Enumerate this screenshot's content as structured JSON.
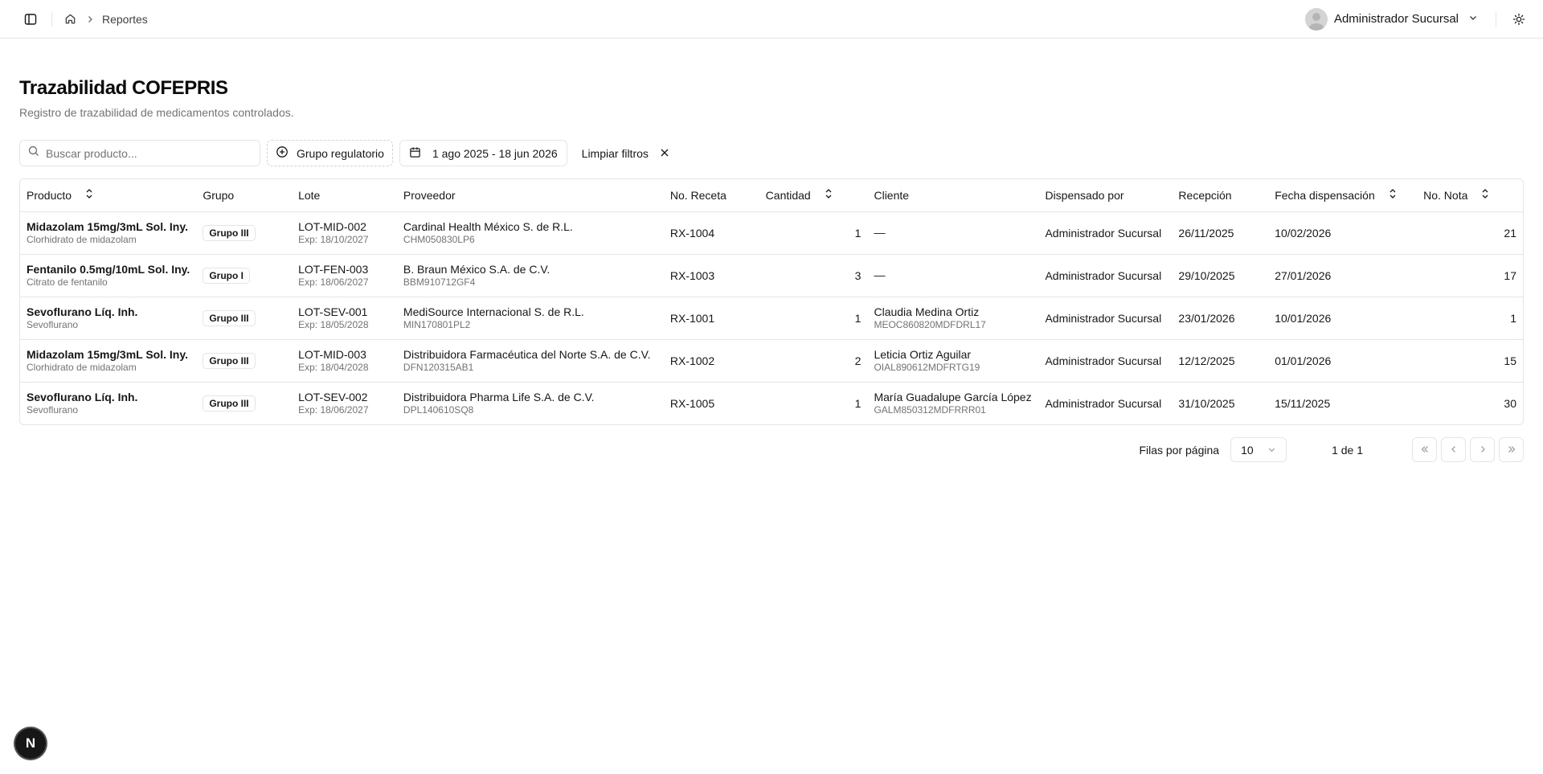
{
  "header": {
    "breadcrumb": [
      "Reportes"
    ],
    "user_name": "Administrador Sucursal"
  },
  "page": {
    "title": "Trazabilidad COFEPRIS",
    "subtitle": "Registro de trazabilidad de medicamentos controlados."
  },
  "filters": {
    "search_placeholder": "Buscar producto...",
    "group_filter_label": "Grupo regulatorio",
    "date_range": "1 ago 2025 - 18 jun 2026",
    "clear_label": "Limpiar filtros"
  },
  "table": {
    "columns": [
      "Producto",
      "Grupo",
      "Lote",
      "Proveedor",
      "No. Receta",
      "Cantidad",
      "Cliente",
      "Dispensado por",
      "Recepción",
      "Fecha dispensación",
      "No. Nota"
    ],
    "rows": [
      {
        "product": "Midazolam 15mg/3mL Sol. Iny.",
        "substance": "Clorhidrato de midazolam",
        "group": "Grupo III",
        "lot": "LOT-MID-002",
        "expiry": "Exp: 18/10/2027",
        "supplier": "Cardinal Health México S. de R.L.",
        "supplier_rfc": "CHM050830LP6",
        "prescription": "RX-1004",
        "quantity": "1",
        "client": "—",
        "client_curp": "",
        "dispensed_by": "Administrador Sucursal",
        "reception": "26/11/2025",
        "dispense_date": "10/02/2026",
        "note": "21"
      },
      {
        "product": "Fentanilo 0.5mg/10mL Sol. Iny.",
        "substance": "Citrato de fentanilo",
        "group": "Grupo I",
        "lot": "LOT-FEN-003",
        "expiry": "Exp: 18/06/2027",
        "supplier": "B. Braun México S.A. de C.V.",
        "supplier_rfc": "BBM910712GF4",
        "prescription": "RX-1003",
        "quantity": "3",
        "client": "—",
        "client_curp": "",
        "dispensed_by": "Administrador Sucursal",
        "reception": "29/10/2025",
        "dispense_date": "27/01/2026",
        "note": "17"
      },
      {
        "product": "Sevoflurano Líq. Inh.",
        "substance": "Sevoflurano",
        "group": "Grupo III",
        "lot": "LOT-SEV-001",
        "expiry": "Exp: 18/05/2028",
        "supplier": "MediSource Internacional S. de R.L.",
        "supplier_rfc": "MIN170801PL2",
        "prescription": "RX-1001",
        "quantity": "1",
        "client": "Claudia Medina Ortiz",
        "client_curp": "MEOC860820MDFDRL17",
        "dispensed_by": "Administrador Sucursal",
        "reception": "23/01/2026",
        "dispense_date": "10/01/2026",
        "note": "1"
      },
      {
        "product": "Midazolam 15mg/3mL Sol. Iny.",
        "substance": "Clorhidrato de midazolam",
        "group": "Grupo III",
        "lot": "LOT-MID-003",
        "expiry": "Exp: 18/04/2028",
        "supplier": "Distribuidora Farmacéutica del Norte S.A. de C.V.",
        "supplier_rfc": "DFN120315AB1",
        "prescription": "RX-1002",
        "quantity": "2",
        "client": "Leticia Ortiz Aguilar",
        "client_curp": "OIAL890612MDFRTG19",
        "dispensed_by": "Administrador Sucursal",
        "reception": "12/12/2025",
        "dispense_date": "01/01/2026",
        "note": "15"
      },
      {
        "product": "Sevoflurano Líq. Inh.",
        "substance": "Sevoflurano",
        "group": "Grupo III",
        "lot": "LOT-SEV-002",
        "expiry": "Exp: 18/06/2027",
        "supplier": "Distribuidora Pharma Life S.A. de C.V.",
        "supplier_rfc": "DPL140610SQ8",
        "prescription": "RX-1005",
        "quantity": "1",
        "client": "María Guadalupe García López",
        "client_curp": "GALM850312MDFRRR01",
        "dispensed_by": "Administrador Sucursal",
        "reception": "31/10/2025",
        "dispense_date": "15/11/2025",
        "note": "30"
      }
    ]
  },
  "pagination": {
    "rows_per_page_label": "Filas por página",
    "rows_per_page_value": "10",
    "page_info": "1 de 1"
  },
  "fab_label": "N"
}
